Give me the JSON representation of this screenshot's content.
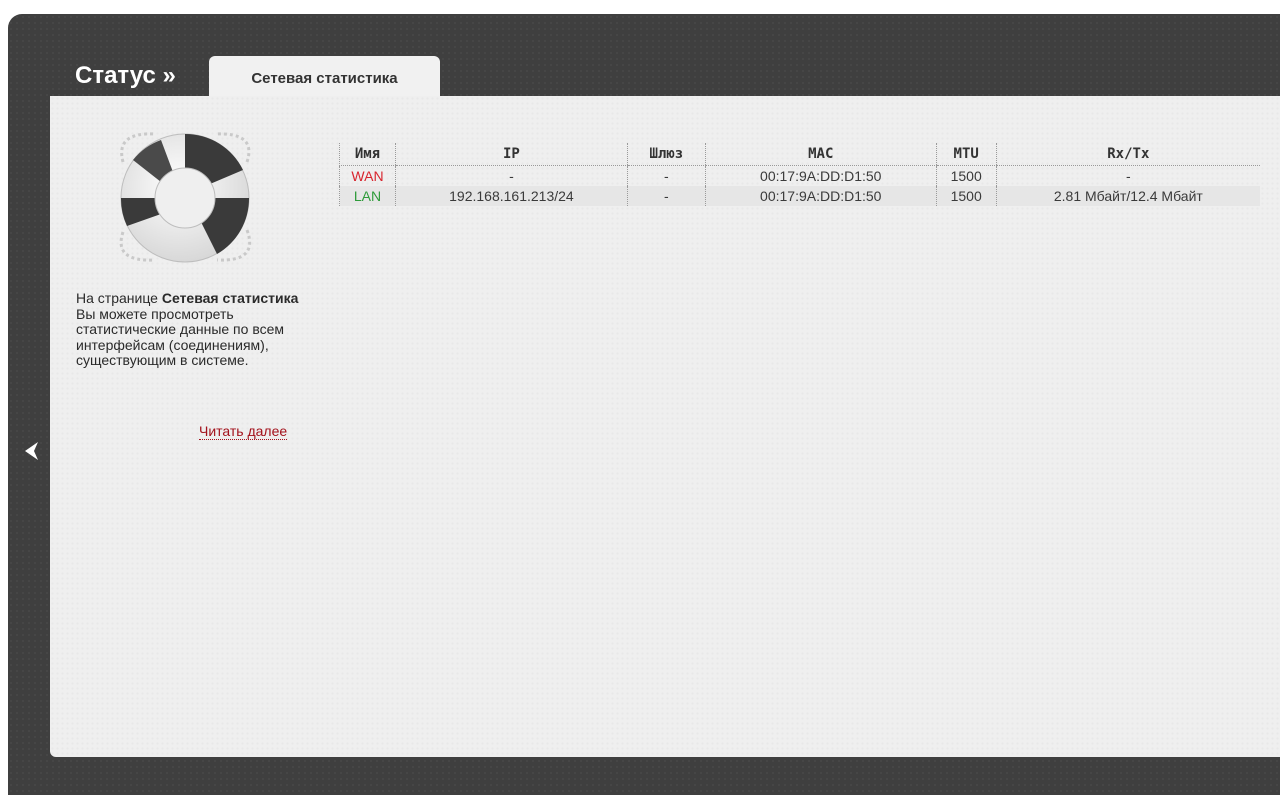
{
  "header": {
    "section_title": "Статус »",
    "active_tab": "Сетевая статистика"
  },
  "help": {
    "prefix": "На странице ",
    "bold": "Сетевая статистика",
    "suffix": " Вы можете просмотреть статистические данные по всем интерфейсам (соединениям), существующим в системе.",
    "read_more": "Читать далее"
  },
  "table": {
    "headers": [
      "Имя",
      "IP",
      "Шлюз",
      "MAC",
      "MTU",
      "Rx/Tx"
    ],
    "rows": [
      {
        "name": "WAN",
        "ip": "-",
        "gateway": "-",
        "mac": "00:17:9A:DD:D1:50",
        "mtu": "1500",
        "rxtx": "-"
      },
      {
        "name": "LAN",
        "ip": "192.168.161.213/24",
        "gateway": "-",
        "mac": "00:17:9A:DD:D1:50",
        "mtu": "1500",
        "rxtx": "2.81 Мбайт/12.4 Мбайт"
      }
    ]
  },
  "colors": {
    "wan": "#d8252e",
    "lan": "#2e9b3a",
    "link": "#a3111b"
  },
  "icons": {
    "illustration": "lifebuoy-icon",
    "nav_back": "chevron-left-icon"
  }
}
